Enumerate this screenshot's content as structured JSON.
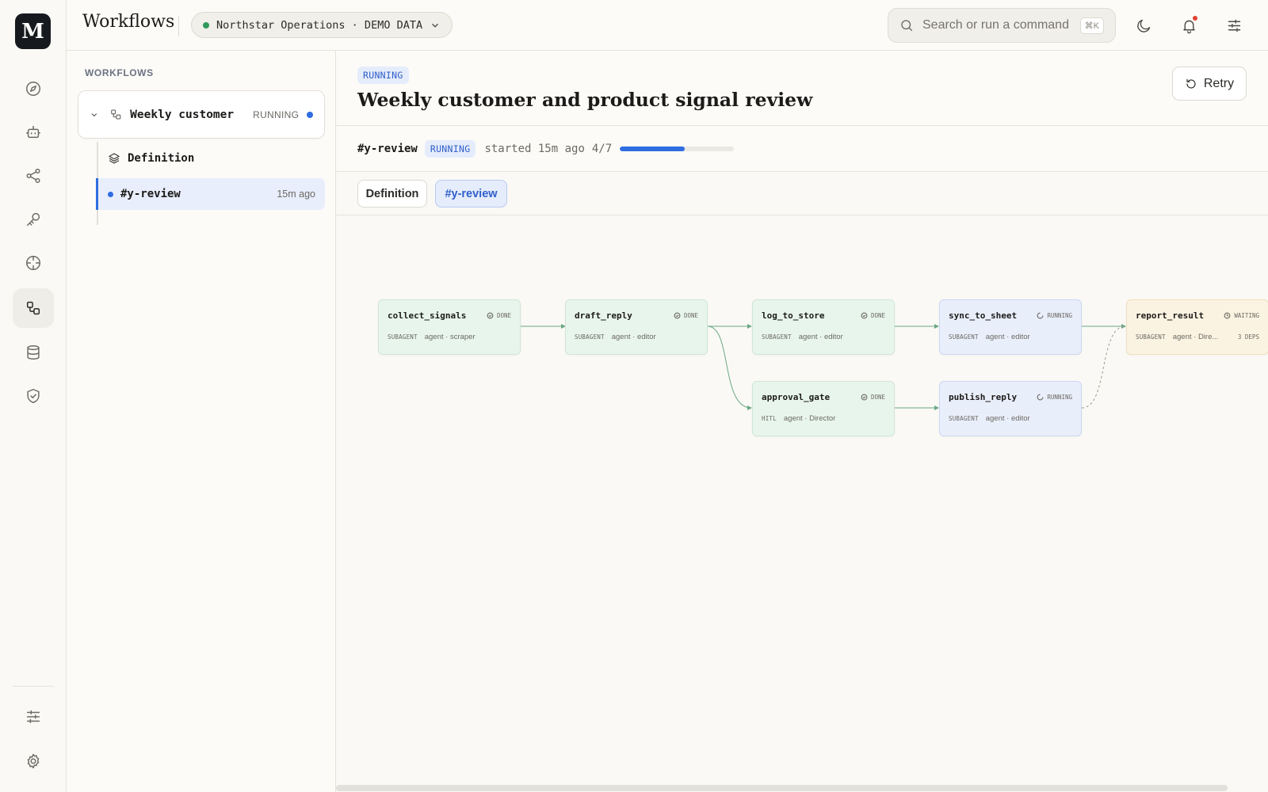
{
  "brand": {
    "logo_letter": "M"
  },
  "rail": {
    "items": [
      {
        "name": "compass-icon"
      },
      {
        "name": "bot-icon"
      },
      {
        "name": "share-icon"
      },
      {
        "name": "key-icon"
      },
      {
        "name": "crosshair-icon"
      },
      {
        "name": "workflow-icon",
        "active": true
      },
      {
        "name": "database-icon"
      },
      {
        "name": "shield-icon"
      }
    ],
    "bottom": [
      {
        "name": "sliders-icon"
      },
      {
        "name": "gear-icon"
      }
    ]
  },
  "topbar": {
    "title": "Workflows",
    "org": {
      "label": "Northstar Operations · DEMO DATA",
      "dot_color": "#2f9a5c"
    },
    "search": {
      "placeholder": "Search or run a command",
      "shortcut": "⌘K"
    }
  },
  "sidebar": {
    "heading": "WORKFLOWS",
    "workflow": {
      "name": "Weekly customer and product signal review",
      "name_display": "Weekly customer …",
      "status": "RUNNING"
    },
    "definition_label": "Definition",
    "run": {
      "name": "#y-review",
      "time": "15m ago"
    }
  },
  "main": {
    "status_badge": "RUNNING",
    "title": "Weekly customer and product signal review",
    "retry_label": "Retry",
    "run_bar": {
      "run_id": "#y-review",
      "status": "RUNNING",
      "started": "started 15m ago",
      "progress_text": "4/7",
      "progress_fraction": 0.571
    },
    "tabs": [
      {
        "label": "Definition"
      },
      {
        "label": "#y-review",
        "active": true
      }
    ]
  },
  "graph": {
    "nodes": [
      {
        "id": "collect_signals",
        "status": "DONE",
        "kind": "SUBAGENT",
        "agent": "agent · scraper"
      },
      {
        "id": "draft_reply",
        "status": "DONE",
        "kind": "SUBAGENT",
        "agent": "agent · editor"
      },
      {
        "id": "log_to_store",
        "status": "DONE",
        "kind": "SUBAGENT",
        "agent": "agent · editor"
      },
      {
        "id": "sync_to_sheet",
        "status": "RUNNING",
        "kind": "SUBAGENT",
        "agent": "agent · editor"
      },
      {
        "id": "report_result",
        "status": "WAITING",
        "kind": "SUBAGENT",
        "agent": "agent · Dire...",
        "deps": "3 DEPS"
      },
      {
        "id": "approval_gate",
        "status": "DONE",
        "kind": "HITL",
        "agent": "agent · Director"
      },
      {
        "id": "publish_reply",
        "status": "RUNNING",
        "kind": "SUBAGENT",
        "agent": "agent · editor"
      }
    ],
    "colors": {
      "done": "#e8f5ed",
      "running": "#e9eefb",
      "waiting": "#fbf3e2",
      "edge": "#6aa884"
    }
  }
}
